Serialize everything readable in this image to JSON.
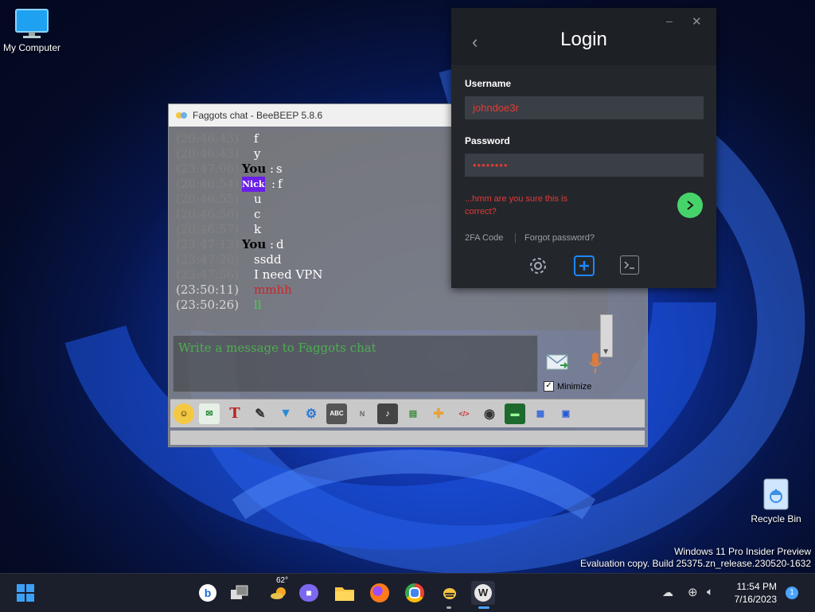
{
  "desktop": {
    "icons": [
      {
        "label": "My Computer"
      },
      {
        "label": "Recycle Bin"
      }
    ],
    "watermark": {
      "line1": "Windows 11 Pro Insider Preview",
      "line2": "Evaluation copy. Build 25375.zn_release.230520-1632"
    }
  },
  "beebeep": {
    "title": "Faggots chat - BeeBEEP 5.8.6",
    "messages": [
      {
        "time": "(20:46:43)",
        "sender": "",
        "text": "f"
      },
      {
        "time": "(20:46:43)",
        "sender": "",
        "text": "y"
      },
      {
        "time": "(23:47:06)",
        "sender": "You",
        "text": "s"
      },
      {
        "time": "(20:46:54)",
        "sender": "Nick",
        "text": "f"
      },
      {
        "time": "(20:46:55)",
        "sender": "",
        "text": "u"
      },
      {
        "time": "(20:46:56)",
        "sender": "",
        "text": "c"
      },
      {
        "time": "(20:46:57)",
        "sender": "",
        "text": "k"
      },
      {
        "time": "(23:47:13)",
        "sender": "You",
        "text": "d"
      },
      {
        "time": "(23:47:20)",
        "sender": "",
        "text": "ssdd"
      },
      {
        "time": "(23:47:56)",
        "sender": "",
        "text": "I need VPN"
      },
      {
        "time": "(23:50:11)",
        "sender": "",
        "text": "mmhh"
      },
      {
        "time": "(23:50:26)",
        "sender": "",
        "text": "ll"
      }
    ],
    "input_placeholder": "Write a message to Faggots chat",
    "minimize_label": "Minimize",
    "minimize_checked": true,
    "toolbar_icons": [
      "emoticons-icon",
      "mail-icon",
      "font-icon",
      "pen-icon",
      "filter-icon",
      "settings-icon",
      "spellcheck-icon",
      "notes-icon",
      "file-icon",
      "save-icon",
      "share-icon",
      "code-icon",
      "record-icon",
      "screenshot-icon",
      "clipboard-icon",
      "save-chat-icon"
    ]
  },
  "login": {
    "title": "Login",
    "username_label": "Username",
    "username_value": "johndoe3r",
    "password_label": "Password",
    "password_value": "••••••••",
    "error_text": "...hmm are you sure this is correct?",
    "twofa_label": "2FA Code",
    "forgot_label": "Forgot password?"
  },
  "taskbar": {
    "weather_temp": "62°",
    "time": "11:54 PM",
    "date": "7/16/2023",
    "notification_count": "1"
  }
}
